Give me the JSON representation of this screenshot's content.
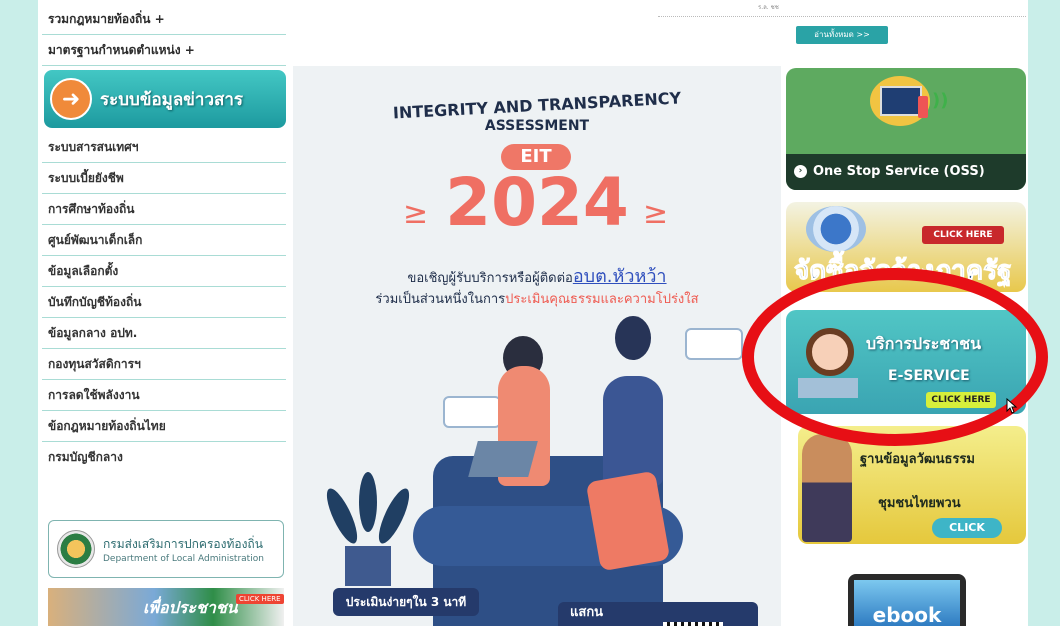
{
  "sidebar": {
    "top_items": [
      "รวมกฎหมายท้องถิ่น +",
      "มาตรฐานกำหนดตำแหน่ง +"
    ],
    "info_banner": {
      "arrow": "➜",
      "label": "ระบบข้อมูลข่าวสาร"
    },
    "items": [
      "ระบบสารสนเทศฯ",
      "ระบบเบี้ยยังชีพ",
      "การศึกษาท้องถิ่น",
      "ศูนย์พัฒนาเด็กเล็ก",
      "ข้อมูลเลือกตั้ง",
      "บันทึกบัญชีท้องถิ่น",
      "ข้อมูลกลาง อปท.",
      "กองทุนสวัสดิการฯ",
      "การลดใช้พลังงาน",
      "ข้อกฎหมายท้องถิ่นไทย",
      "กรมบัญชีกลาง"
    ],
    "dla": {
      "thai": "กรมส่งเสริมการปกครองท้องถิ่น",
      "english": "Department of Local Administration"
    },
    "bottom_banner": {
      "text": "เพื่อประชาชน",
      "click": "CLICK HERE"
    }
  },
  "center": {
    "top_small": "ร.ล. ชช",
    "read_all": "อ่านทั้งหมด >>",
    "poster": {
      "title_line1": "INTEGRITY AND TRANSPARENCY",
      "title_line2": "ASSESSMENT",
      "pill": "EIT",
      "year": "2024",
      "deco": "≥",
      "invite_prefix": "ขอเชิญผู้รับบริการหรือผู้ติดต่อ",
      "invite_org": "อบต.หัวหว้า",
      "join_prefix": "ร่วมเป็นส่วนหนึ่งในการ",
      "join_highlight": "ประเมินคุณธรรมและความโปร่งใส",
      "easy": "ประเมินง่ายๆใน 3 นาที",
      "scan": "แสกน"
    }
  },
  "right": {
    "oss": {
      "label": "One Stop Service (OSS)",
      "arrow": "›",
      "wifi": "))"
    },
    "procurement": {
      "click": "CLICK HERE",
      "title": "จัดซื้อจัดจ้างภาครัฐ"
    },
    "eservice": {
      "line1": "บริการประชาชน",
      "line2": "E-SERVICE",
      "click": "CLICK HERE"
    },
    "culture": {
      "line1": "ฐานข้อมูลวัฒนธรรม",
      "line2": "ชุมชนไทยพวน",
      "click": "CLICK"
    },
    "ebook": "ebook"
  },
  "colors": {
    "highlight_ring": "#e70f15",
    "page_bg": "#c9eee9",
    "accent": "#2aa3a6"
  }
}
